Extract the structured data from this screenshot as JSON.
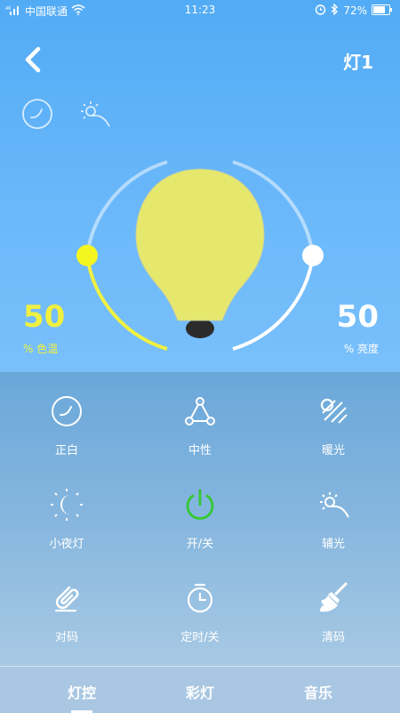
{
  "status": {
    "signal": "⁴⁶",
    "carrier": "中国联通",
    "time": "11:23",
    "battery": "72%"
  },
  "header": {
    "title": "灯1"
  },
  "color_temp": {
    "value": "50",
    "label": "% 色温",
    "color": "#f0f040"
  },
  "brightness": {
    "value": "50",
    "label": "% 亮度"
  },
  "panel": {
    "items": [
      {
        "label": "正白",
        "icon": "moon-circle-icon"
      },
      {
        "label": "中性",
        "icon": "triangle-nodes-icon"
      },
      {
        "label": "暖光",
        "icon": "warm-light-icon"
      },
      {
        "label": "小夜灯",
        "icon": "night-light-icon"
      },
      {
        "label": "开/关",
        "icon": "power-icon",
        "color": "#32c832"
      },
      {
        "label": "辅光",
        "icon": "aux-light-icon"
      },
      {
        "label": "对码",
        "icon": "pair-icon"
      },
      {
        "label": "定时/关",
        "icon": "timer-icon"
      },
      {
        "label": "清码",
        "icon": "clear-icon"
      }
    ]
  },
  "tabs": [
    {
      "label": "灯控",
      "active": true
    },
    {
      "label": "彩灯",
      "active": false
    },
    {
      "label": "音乐",
      "active": false
    }
  ]
}
